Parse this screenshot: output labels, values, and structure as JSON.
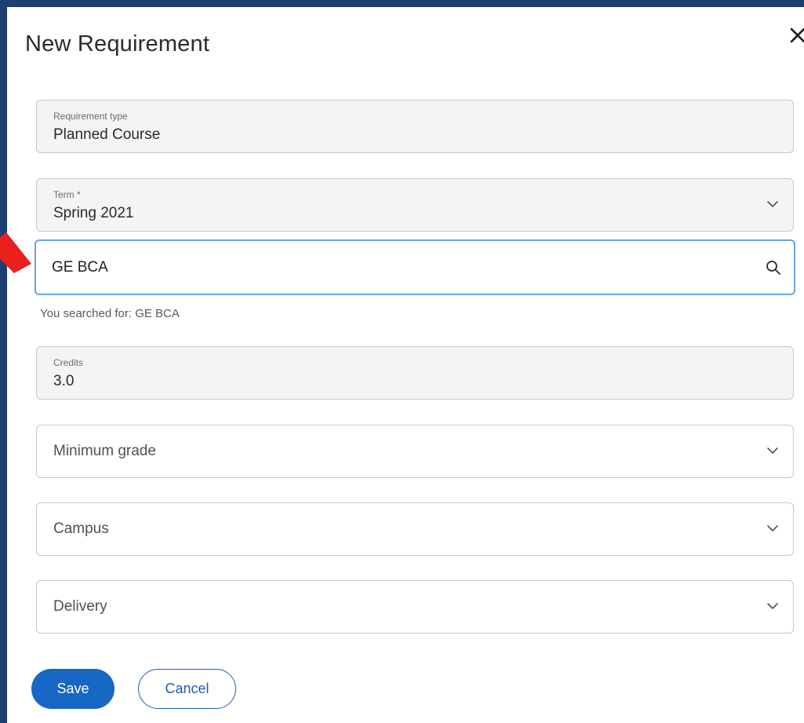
{
  "dialog": {
    "title": "New Requirement"
  },
  "requirement_type": {
    "label": "Requirement type",
    "value": "Planned Course"
  },
  "term": {
    "label": "Term *",
    "value": "Spring 2021"
  },
  "course_search": {
    "value": "GE BCA",
    "searched_text": "You searched for: GE BCA"
  },
  "credits": {
    "label": "Credits",
    "value": "3.0"
  },
  "minimum_grade": {
    "placeholder": "Minimum grade"
  },
  "campus": {
    "placeholder": "Campus"
  },
  "delivery": {
    "placeholder": "Delivery"
  },
  "actions": {
    "save_label": "Save",
    "cancel_label": "Cancel"
  },
  "icons": {
    "close": "close-icon",
    "chevron": "chevron-down-icon",
    "search": "search-icon",
    "annotation": "red-arrow-icon"
  },
  "colors": {
    "background": "#1d3f72",
    "primary": "#1767c4",
    "focus_border": "#6aa5e3",
    "annotation_arrow": "#e8201e"
  }
}
